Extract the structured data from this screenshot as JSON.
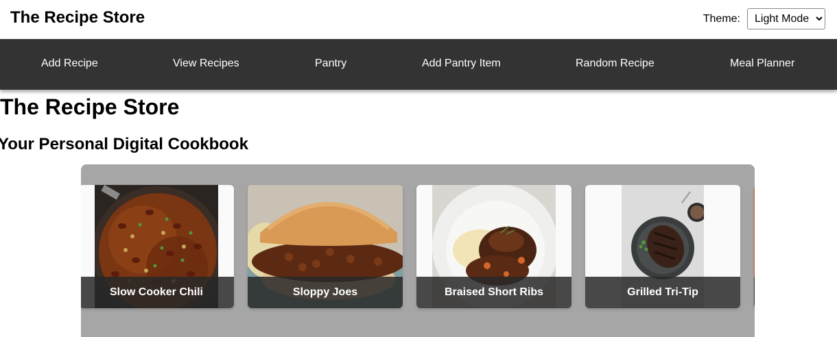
{
  "header": {
    "app_title": "The Recipe Store",
    "theme_label": "Theme:",
    "theme_selected": "Light Mode",
    "theme_options": [
      "Light Mode"
    ]
  },
  "nav": {
    "items": [
      {
        "label": "Add Recipe"
      },
      {
        "label": "View Recipes"
      },
      {
        "label": "Pantry"
      },
      {
        "label": "Add Pantry Item"
      },
      {
        "label": "Random Recipe"
      },
      {
        "label": "Meal Planner"
      }
    ]
  },
  "main": {
    "heading": "The Recipe Store",
    "subheading": "Your Personal Digital Cookbook"
  },
  "carousel": {
    "cards": [
      {
        "title": "Slow Cooker Chili"
      },
      {
        "title": "Sloppy Joes"
      },
      {
        "title": "Braised Short Ribs"
      },
      {
        "title": "Grilled Tri-Tip"
      }
    ]
  },
  "colors": {
    "navbar": "#333333",
    "carousel_bg": "#a6a6a6",
    "label_overlay": "#282828"
  }
}
